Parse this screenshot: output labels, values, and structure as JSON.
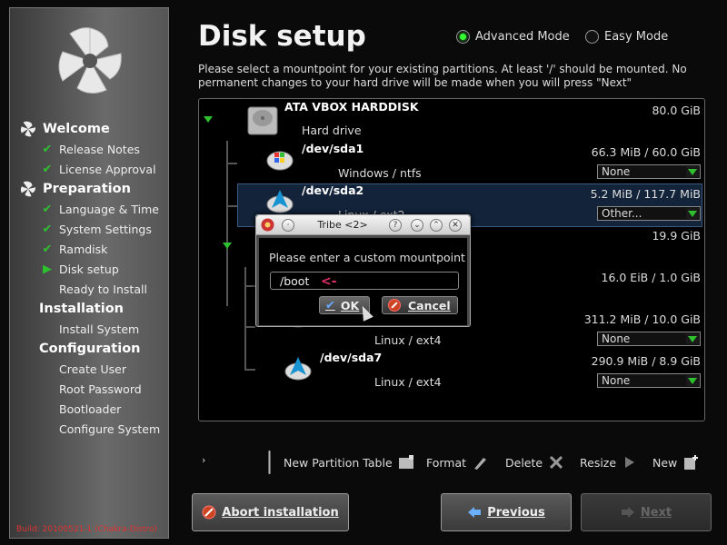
{
  "sidebar": {
    "sections": [
      {
        "label": "Welcome",
        "steps": [
          {
            "label": "Release Notes",
            "state": "done"
          },
          {
            "label": "License Approval",
            "state": "done"
          }
        ]
      },
      {
        "label": "Preparation",
        "steps": [
          {
            "label": "Language & Time",
            "state": "done"
          },
          {
            "label": "System Settings",
            "state": "done"
          },
          {
            "label": "Ramdisk",
            "state": "done"
          },
          {
            "label": "Disk setup",
            "state": "current"
          },
          {
            "label": "Ready to Install",
            "state": "pending"
          }
        ]
      },
      {
        "label": "Installation",
        "steps": [
          {
            "label": "Install System",
            "state": "pending"
          }
        ]
      },
      {
        "label": "Configuration",
        "steps": [
          {
            "label": "Create User",
            "state": "pending"
          },
          {
            "label": "Root Password",
            "state": "pending"
          },
          {
            "label": "Bootloader",
            "state": "pending"
          },
          {
            "label": "Configure System",
            "state": "pending"
          }
        ]
      }
    ],
    "build": "Build: 20100521-1 (Chakra-Distro)"
  },
  "header": {
    "title": "Disk setup",
    "advanced_mode": "Advanced Mode",
    "easy_mode": "Easy Mode",
    "selected_mode": "advanced",
    "description": "Please select a mountpoint for your existing partitions. At least '/' should be mounted. No permanent changes to your hard drive will be made when you will press \"Next\""
  },
  "disk": {
    "name": "ATA VBOX HARDDISK",
    "type": "Hard drive",
    "size": "80.0 GiB",
    "partitions": [
      {
        "device": "/dev/sda1",
        "fs": "Windows / ntfs",
        "size": "66.3 MiB / 60.0 GiB",
        "mount": "None"
      },
      {
        "device": "/dev/sda2",
        "fs": "Linux / ext2",
        "size": "5.2 MiB / 117.7 MiB",
        "mount": "Other..."
      },
      {
        "device": "",
        "fs": "",
        "size": "19.9 GiB",
        "mount": ""
      },
      {
        "device": "",
        "fs": "",
        "size": "16.0 EiB / 1.0 GiB",
        "mount": ""
      },
      {
        "device": "",
        "fs": "Linux / ext4",
        "size": "311.2 MiB / 10.0 GiB",
        "mount": "None"
      },
      {
        "device": "/dev/sda7",
        "fs": "Linux / ext4",
        "size": "290.9 MiB / 8.9 GiB",
        "mount": "None"
      }
    ]
  },
  "dialog": {
    "title": "Tribe <2>",
    "prompt": "Please enter a custom mountpoint",
    "input_value": "/boot",
    "annotation": "<-",
    "ok": "OK",
    "cancel": "Cancel",
    "btn_help": "?"
  },
  "toolbar": {
    "expander": "›",
    "new_partition_table": "New Partition Table",
    "format": "Format",
    "delete": "Delete",
    "resize": "Resize",
    "new": "New"
  },
  "buttons": {
    "abort": "Abort installation",
    "previous": "Previous",
    "next": "Next"
  }
}
